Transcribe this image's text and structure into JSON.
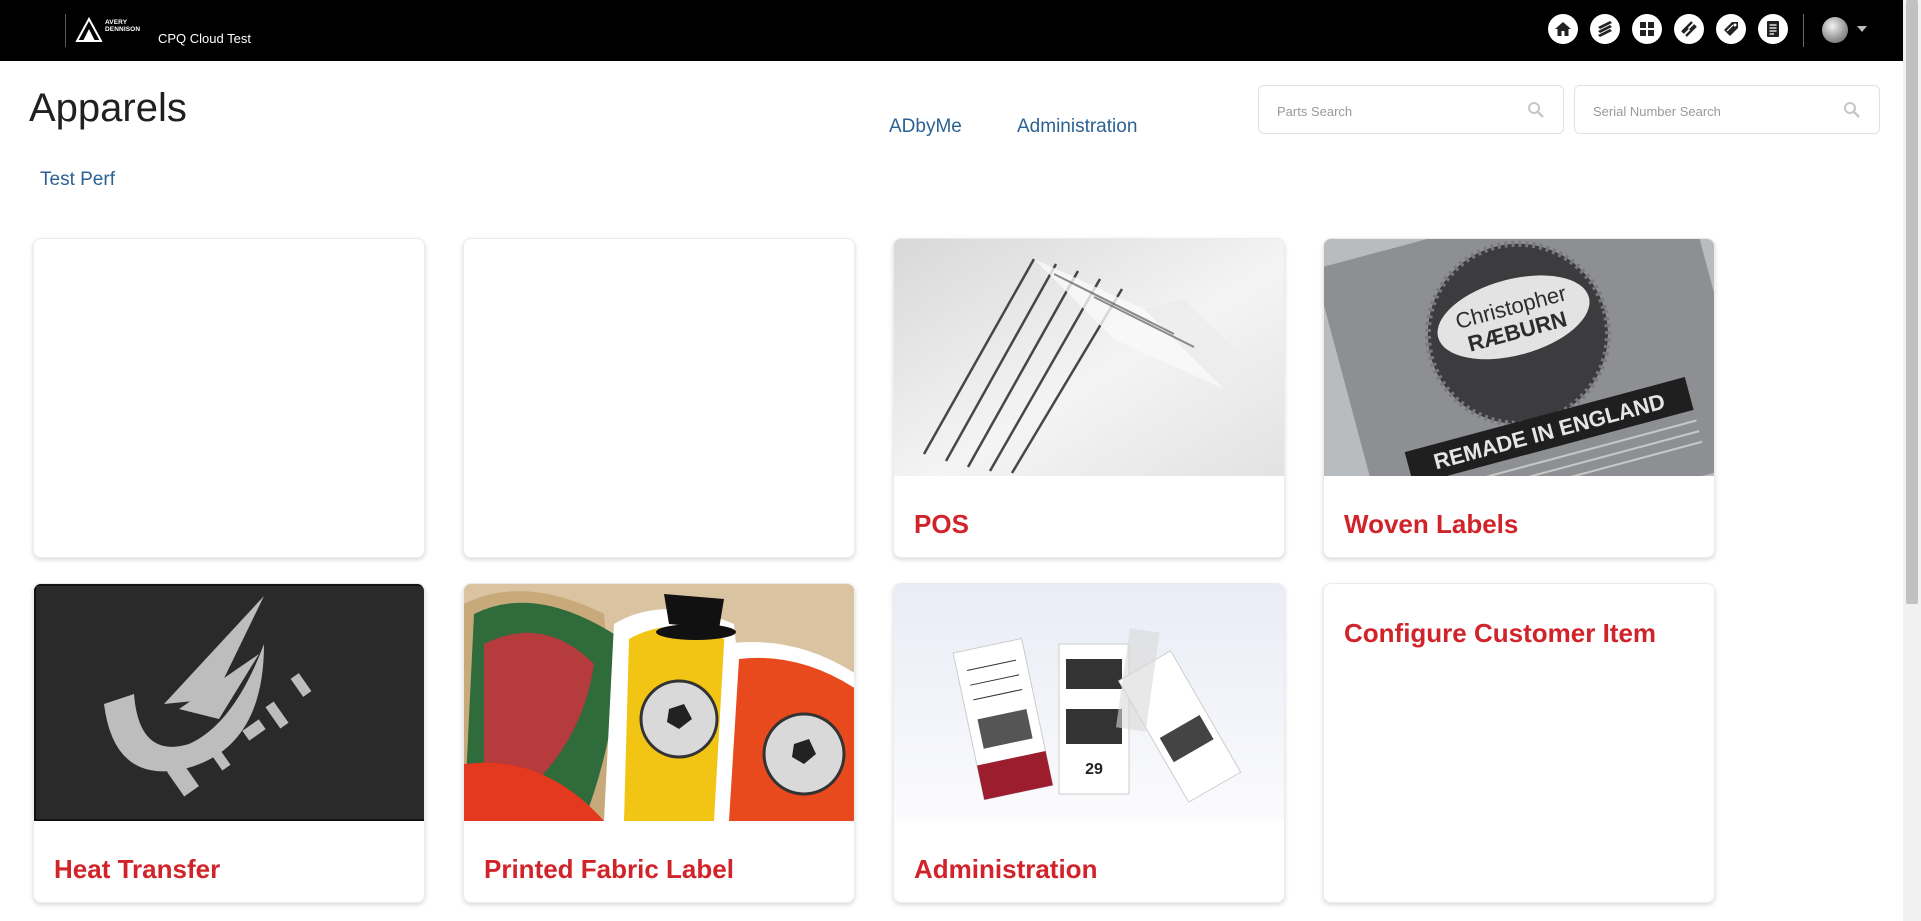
{
  "header": {
    "logo_line1": "AVERY",
    "logo_line2": "DENNISON",
    "app_title": "CPQ Cloud Test",
    "nav_icons": [
      "home-icon",
      "layers-icon",
      "grid-icon",
      "link-icon",
      "tag-icon",
      "document-icon"
    ],
    "avatar": "user-avatar"
  },
  "page": {
    "title": "Apparels",
    "links": {
      "adbyme": "ADbyMe",
      "administration": "Administration",
      "test_perf": "Test Perf"
    }
  },
  "search": {
    "parts_placeholder": "Parts Search",
    "serial_placeholder": "Serial Number Search"
  },
  "cards": [
    {
      "title": "",
      "image": "none"
    },
    {
      "title": "",
      "image": "none"
    },
    {
      "title": "POS",
      "image": "rfid-tags-photo"
    },
    {
      "title": "Woven Labels",
      "image": "woven-label-photo"
    },
    {
      "title": "Heat Transfer",
      "image": "heat-transfer-logo-photo"
    },
    {
      "title": "Printed Fabric Label",
      "image": "printed-patches-photo"
    },
    {
      "title": "Administration",
      "image": "price-tags-photo"
    },
    {
      "title": "Configure Customer Item",
      "image": "none"
    }
  ],
  "colors": {
    "topbar": "#000000",
    "link": "#2c6293",
    "card_title": "#d1242a"
  }
}
